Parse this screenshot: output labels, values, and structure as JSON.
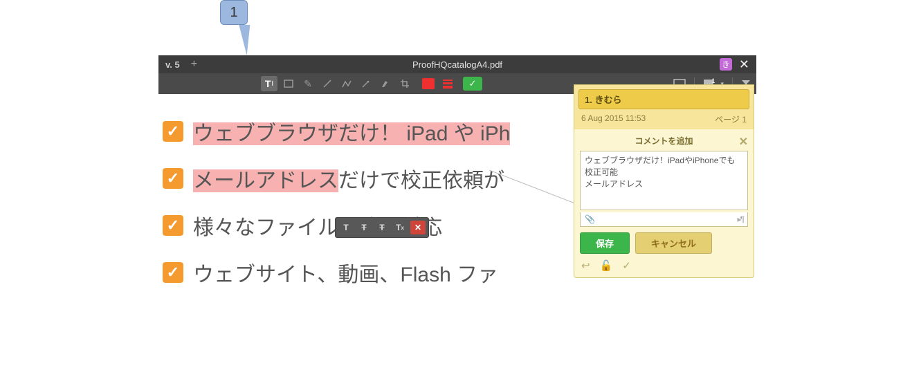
{
  "callout": {
    "label": "1"
  },
  "header": {
    "version_label": "v. 5",
    "filename": "ProofHQcatalogA4.pdf",
    "user_badge": "き"
  },
  "toolbar": {
    "comment_count": "1"
  },
  "document_lines": [
    {
      "prefix_hl": "ウェブブラウザだけ！ iPad や iPh",
      "rest": "",
      "all_hl": true
    },
    {
      "prefix_hl": "メールアドレス",
      "rest": "だけで校正依頼が",
      "all_hl": false
    },
    {
      "prefix_hl": "",
      "rest": "様々なファイル形式に対応",
      "all_hl": false
    },
    {
      "prefix_hl": "",
      "rest": "ウェブサイト、動画、Flash ファ",
      "all_hl": false
    }
  ],
  "mini_toolbar": {
    "t1": "T",
    "t2": "T",
    "t3": "T",
    "t4": "T",
    "close": "✕"
  },
  "comments": {
    "author_line": "1. きむら",
    "timestamp": "6 Aug 2015 11:53",
    "page_label": "ページ 1",
    "add_title": "コメントを追加",
    "draft_text": "ウェブブラウザだけ！iPadやiPhoneでも校正可能\nメールアドレス",
    "save_label": "保存",
    "cancel_label": "キャンセル",
    "pilcrow": "¶"
  }
}
